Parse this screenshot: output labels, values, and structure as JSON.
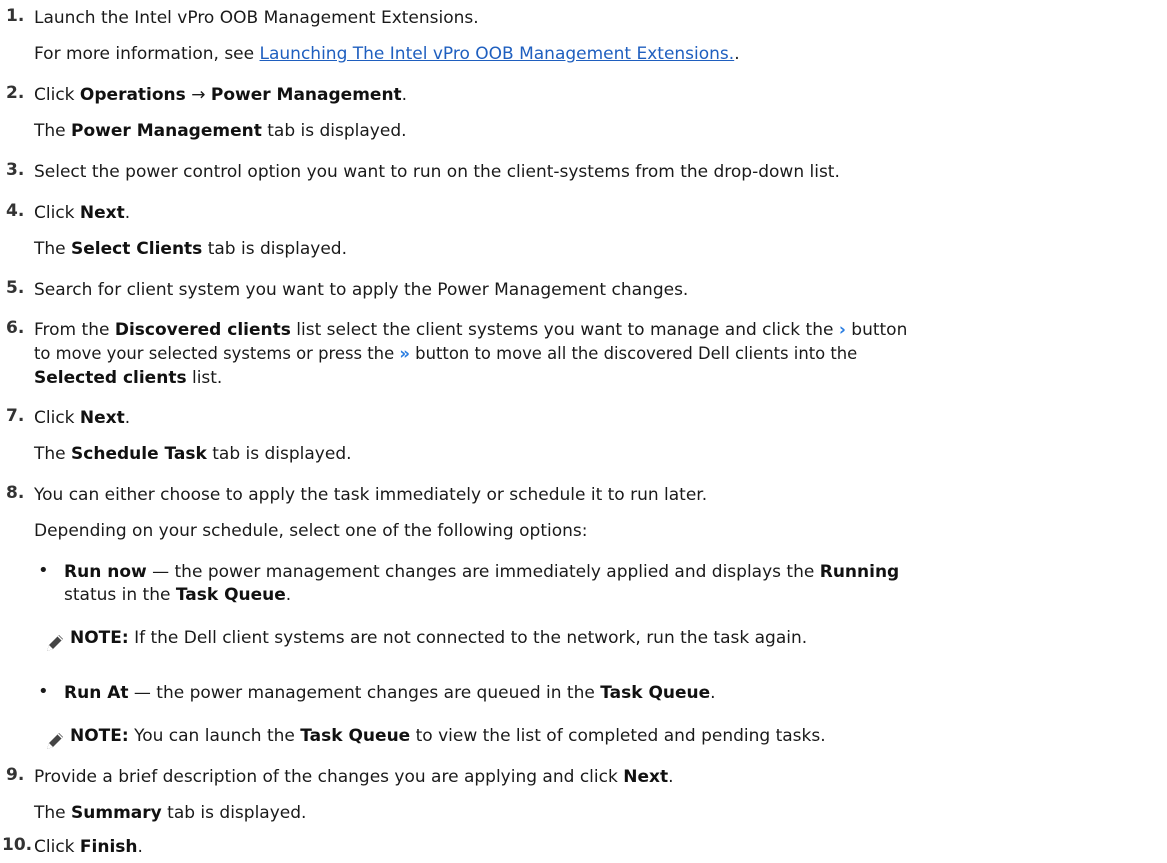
{
  "steps": [
    {
      "num": "1.",
      "text": "Launch the Intel vPro OOB Management Extensions."
    },
    {
      "sub_prefix": "For more information, see ",
      "sub_link": "Launching The Intel vPro OOB Management Extensions.",
      "sub_suffix": "."
    },
    {
      "num": "2.",
      "pre": "Click ",
      "b1": "Operations",
      "arrow": " → ",
      "b2": "Power Management",
      "post": "."
    },
    {
      "sub_pre": "The ",
      "sub_b": "Power Management",
      "sub_post": " tab is displayed."
    },
    {
      "num": "3.",
      "text": "Select the power control option you want to run on the client-systems from the drop-down list."
    },
    {
      "num": "4.",
      "pre": "Click ",
      "b1": "Next",
      "post": "."
    },
    {
      "sub_pre": "The ",
      "sub_b": "Select Clients",
      "sub_post": " tab is displayed."
    },
    {
      "num": "5.",
      "text": "Search for client system you want to apply the Power Management changes."
    },
    {
      "num": "6.",
      "l1_pre": "From the ",
      "l1_b": "Discovered clients",
      "l1_mid": " list select the client systems you want to manage and click the ",
      "l1_chev": "›",
      "l1_post": " button",
      "l2_pre": "to move your selected systems or press the ",
      "l2_chev": "»",
      "l2_post": " button to move all the discovered Dell clients into the",
      "l3_b": "Selected clients",
      "l3_post": " list."
    },
    {
      "num": "7.",
      "pre": "Click ",
      "b1": "Next",
      "post": "."
    },
    {
      "sub_pre": "The ",
      "sub_b": "Schedule Task",
      "sub_post": " tab is displayed."
    },
    {
      "num": "8.",
      "text": "You can either choose to apply the task immediately or schedule it to run later."
    },
    {
      "sub_text": "Depending on your schedule, select one of the following options:"
    },
    {
      "bullet": "•",
      "b1": "Run now",
      "mid": " — the power management changes are immediately applied and displays the ",
      "b2": "Running",
      "l2_pre": "status in the ",
      "l2_b": "Task Queue",
      "l2_post": "."
    },
    {
      "note_label": "NOTE:",
      "note_text": " If the Dell client systems are not connected to the network, run the task again."
    },
    {
      "bullet": "•",
      "b1": "Run At",
      "mid": " — the power management changes are queued in the ",
      "b2": "Task Queue",
      "post": "."
    },
    {
      "note_label": "NOTE:",
      "note_pre": " You can launch the ",
      "note_b": "Task Queue",
      "note_post": " to view the list of completed and pending tasks."
    },
    {
      "num": "9.",
      "pre": "Provide a brief description of the changes you are applying and click ",
      "b1": "Next",
      "post": "."
    },
    {
      "sub_pre": "The ",
      "sub_b": "Summary",
      "sub_post": " tab is displayed."
    },
    {
      "num": "10.",
      "pre": "Click ",
      "b1": "Finish",
      "post": "."
    }
  ],
  "colors": {
    "link": "#1f5fbf",
    "chevron": "#2a7de1",
    "text": "#1a1a1a"
  }
}
